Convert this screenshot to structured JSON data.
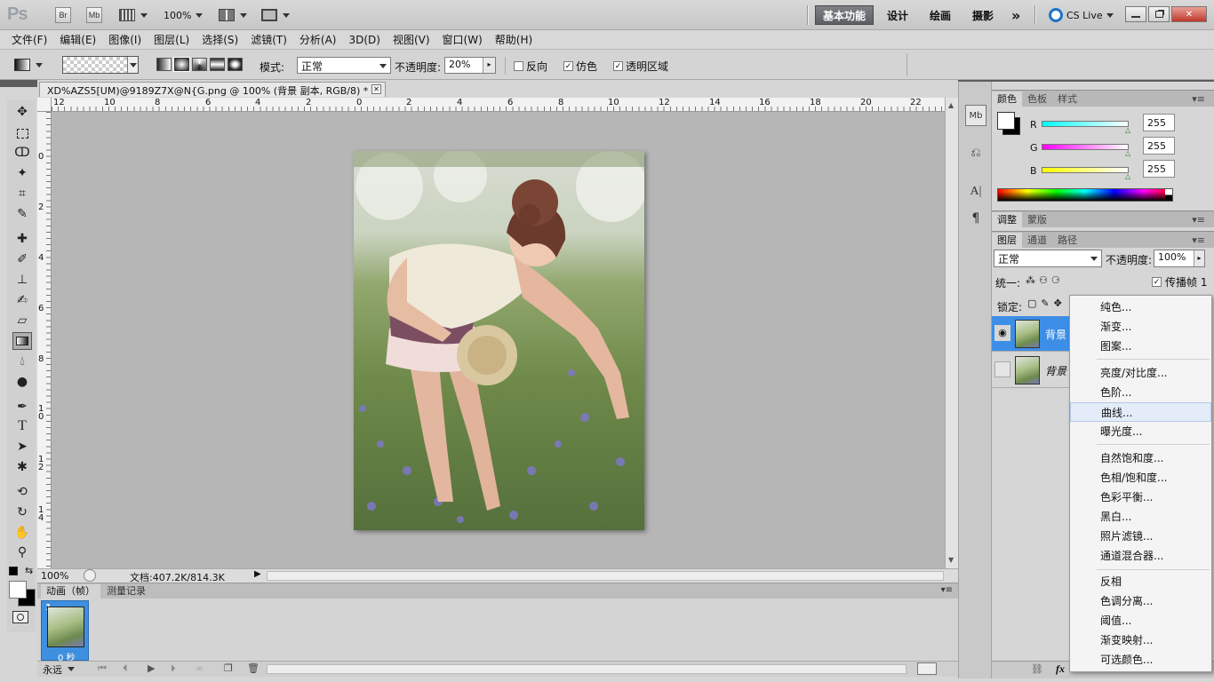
{
  "app": {
    "logo": "Ps",
    "bridge": "Br",
    "minibridge": "Mb",
    "zoom": "100%",
    "cslive": "CS Live",
    "workspaces": [
      "基本功能",
      "设计",
      "绘画",
      "摄影"
    ],
    "more": "»"
  },
  "menu": [
    "文件(F)",
    "编辑(E)",
    "图像(I)",
    "图层(L)",
    "选择(S)",
    "滤镜(T)",
    "分析(A)",
    "3D(D)",
    "视图(V)",
    "窗口(W)",
    "帮助(H)"
  ],
  "options": {
    "mode_label": "模式:",
    "mode_value": "正常",
    "opacity_label": "不透明度:",
    "opacity_value": "20%",
    "reverse": "反向",
    "dither": "仿色",
    "transparency": "透明区域"
  },
  "document": {
    "tab": "XD%AZS5[UM)@9189Z7X@N{G.png @ 100% (背景 副本, RGB/8) *",
    "zoom": "100%",
    "docinfo": "文档:407.2K/814.3K",
    "ruler_top": [
      "12",
      "10",
      "8",
      "6",
      "4",
      "2",
      "0",
      "2",
      "4",
      "6",
      "8",
      "10",
      "12",
      "14",
      "16",
      "18",
      "20",
      "22"
    ],
    "ruler_left": [
      "0",
      "2",
      "4",
      "6",
      "8",
      "1 0",
      "1 2",
      "1 4"
    ]
  },
  "animation": {
    "tab_active": "动画（帧）",
    "tab_other": "测量记录",
    "frame_number": "1",
    "frame_delay": "0 秒",
    "loop": "永远"
  },
  "color_panel": {
    "tabs": [
      "颜色",
      "色板",
      "样式"
    ],
    "r_label": "R",
    "g_label": "G",
    "b_label": "B",
    "r": "255",
    "g": "255",
    "b": "255"
  },
  "adjust_panel": {
    "tabs": [
      "调整",
      "蒙版"
    ]
  },
  "layers_panel": {
    "tabs": [
      "图层",
      "通道",
      "路径"
    ],
    "blend": "正常",
    "opacity_label": "不透明度:",
    "opacity_value": "100%",
    "unify_label": "统一:",
    "propagate": "传播帧 1",
    "lock_label": "锁定:",
    "layers": [
      {
        "name": "背景",
        "selected": true
      },
      {
        "name": "背景",
        "selected": false
      }
    ]
  },
  "context_menu": {
    "groups": [
      [
        "纯色...",
        "渐变...",
        "图案..."
      ],
      [
        "亮度/对比度...",
        "色阶...",
        "曲线...",
        "曝光度..."
      ],
      [
        "自然饱和度...",
        "色相/饱和度...",
        "色彩平衡...",
        "黑白...",
        "照片滤镜...",
        "通道混合器..."
      ],
      [
        "反相",
        "色调分离...",
        "阈值...",
        "渐变映射...",
        "可选颜色..."
      ]
    ],
    "highlighted": "曲线..."
  },
  "colors": {
    "accent": "#3f8fe0",
    "selected_layer": "#3d8ee6",
    "workspace_active": "#6a6e72"
  }
}
